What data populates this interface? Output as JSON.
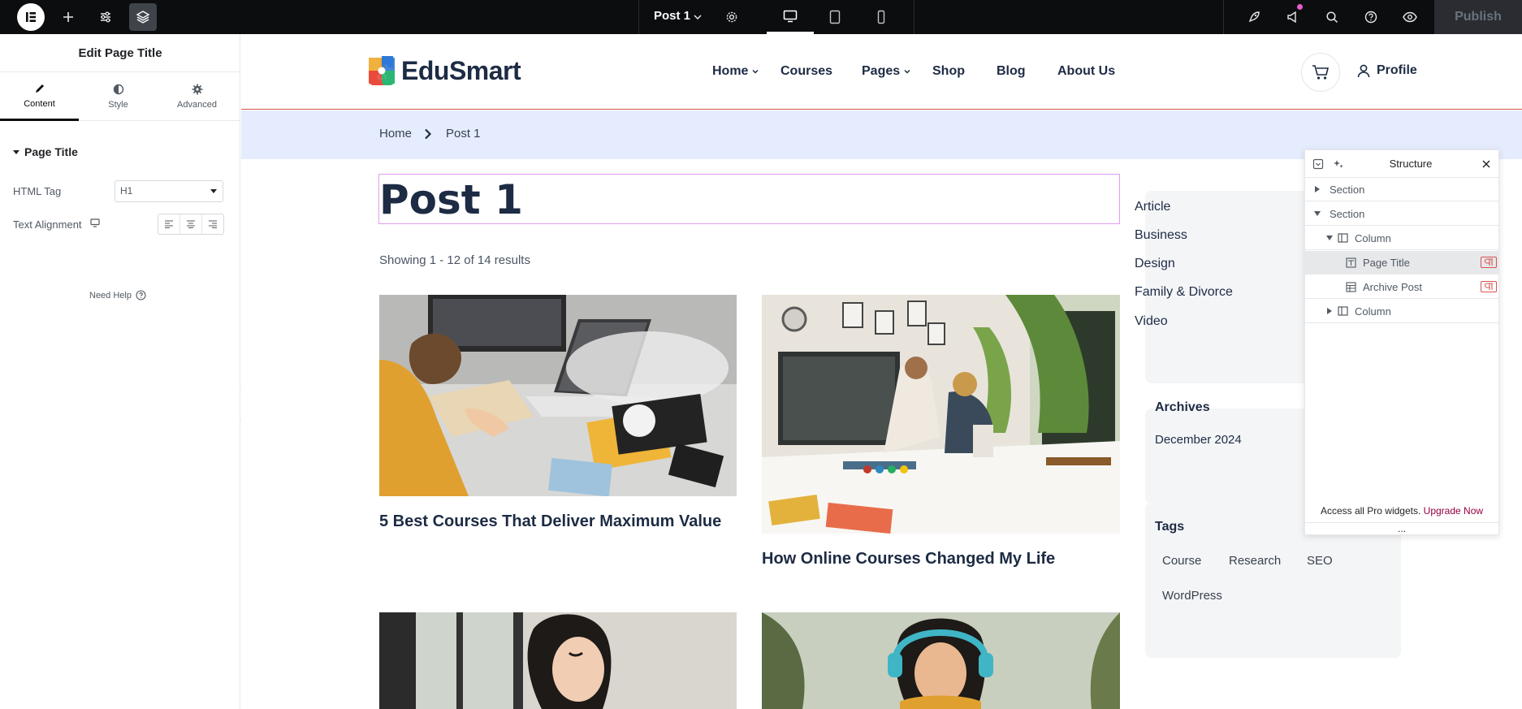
{
  "topbar": {
    "document_title": "Post 1",
    "publish_label": "Publish",
    "icons": [
      "elementor-logo-icon",
      "plus-icon",
      "sliders-icon",
      "layers-icon",
      "chevron-down-icon",
      "gear-icon",
      "desktop-icon",
      "tablet-icon",
      "mobile-icon",
      "rocket-icon",
      "megaphone-icon",
      "search-icon",
      "help-icon",
      "eye-icon"
    ]
  },
  "panel": {
    "title": "Edit Page Title",
    "tabs": [
      {
        "label": "Content",
        "icon": "pencil-icon"
      },
      {
        "label": "Style",
        "icon": "half-circle-icon"
      },
      {
        "label": "Advanced",
        "icon": "gear-icon"
      }
    ],
    "section": "Page Title",
    "html_tag_label": "HTML Tag",
    "html_tag_value": "H1",
    "alignment_label": "Text Alignment",
    "need_help": "Need Help"
  },
  "site": {
    "logo_text": "EduSmart",
    "nav": [
      "Home",
      "Courses",
      "Pages",
      "Shop",
      "Blog",
      "About Us"
    ],
    "profile_label": "Profile",
    "breadcrumb": [
      "Home",
      "Post 1"
    ],
    "page_title": "Post 1",
    "results_text": "Showing 1 - 12 of 14 results",
    "posts": [
      {
        "title": "5 Best Courses That Deliver Maximum Value"
      },
      {
        "title": "How Online Courses Changed My Life"
      }
    ],
    "categories": [
      "Article",
      "Business",
      "Design",
      "Family & Divorce",
      "Video"
    ],
    "archives_title": "Archives",
    "archives": [
      "December 2024"
    ],
    "tags_title": "Tags",
    "tags": [
      "Course",
      "Research",
      "SEO",
      "WordPress"
    ]
  },
  "structure": {
    "title": "Structure",
    "rows": [
      "Section",
      "Section",
      "Column",
      "Page Title",
      "Archive Post",
      "Column"
    ],
    "upgrade_text": "Access all Pro widgets.",
    "upgrade_link": "Upgrade Now",
    "more": "..."
  },
  "colors": {
    "topbar_bg": "#0c0d0e",
    "accent_pink": "#93003f",
    "breadcrumb_bg": "#e5ecfd",
    "title_outline": "#e39cf0",
    "header_border": "#d9534f",
    "notification_dot": "#e45dd2"
  }
}
